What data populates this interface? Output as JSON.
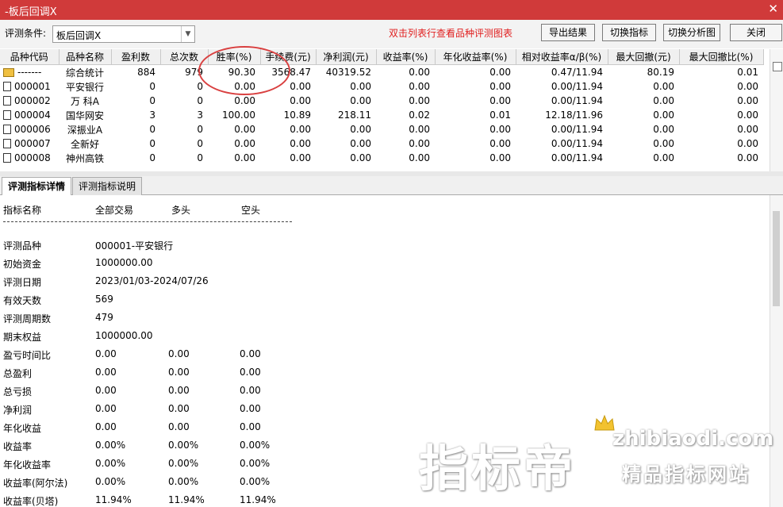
{
  "window": {
    "title": "-板后回调X",
    "close_glyph": "✕"
  },
  "toolbar": {
    "condition_label": "评测条件:",
    "condition_value": "板后回调X",
    "hint": "双击列表行查看品种评测图表",
    "buttons": [
      "导出结果",
      "切换指标",
      "切换分析图",
      "关闭"
    ]
  },
  "grid": {
    "columns": [
      "品种代码",
      "品种名称",
      "盈利数",
      "总次数",
      "胜率(%)",
      "手续费(元)",
      "净利润(元)",
      "收益率(%)",
      "年化收益率(%)",
      "相对收益率α/β(%)",
      "最大回撤(元)",
      "最大回撤比(%)"
    ],
    "rows": [
      [
        "-------",
        "综合统计",
        "884",
        "979",
        "90.30",
        "3568.47",
        "40319.52",
        "0.00",
        "0.00",
        "0.47/11.94",
        "80.19",
        "0.01"
      ],
      [
        "000001",
        "平安银行",
        "0",
        "0",
        "0.00",
        "0.00",
        "0.00",
        "0.00",
        "0.00",
        "0.00/11.94",
        "0.00",
        "0.00"
      ],
      [
        "000002",
        "万 科A",
        "0",
        "0",
        "0.00",
        "0.00",
        "0.00",
        "0.00",
        "0.00",
        "0.00/11.94",
        "0.00",
        "0.00"
      ],
      [
        "000004",
        "国华网安",
        "3",
        "3",
        "100.00",
        "10.89",
        "218.11",
        "0.02",
        "0.01",
        "12.18/11.96",
        "0.00",
        "0.00"
      ],
      [
        "000006",
        "深振业A",
        "0",
        "0",
        "0.00",
        "0.00",
        "0.00",
        "0.00",
        "0.00",
        "0.00/11.94",
        "0.00",
        "0.00"
      ],
      [
        "000007",
        "全新好",
        "0",
        "0",
        "0.00",
        "0.00",
        "0.00",
        "0.00",
        "0.00",
        "0.00/11.94",
        "0.00",
        "0.00"
      ],
      [
        "000008",
        "神州高铁",
        "0",
        "0",
        "0.00",
        "0.00",
        "0.00",
        "0.00",
        "0.00",
        "0.00/11.94",
        "0.00",
        "0.00"
      ]
    ]
  },
  "tabs": [
    "评测指标详情",
    "评测指标说明"
  ],
  "detail": {
    "header": [
      "指标名称",
      "全部交易",
      "多头",
      "空头"
    ],
    "dashes": "------------------------------------------------------------------------",
    "rows": [
      [
        "评测品种",
        "000001-平安银行",
        "",
        ""
      ],
      [
        "初始资金",
        "1000000.00",
        "",
        ""
      ],
      [
        "评测日期",
        "2023/01/03-2024/07/26",
        "",
        ""
      ],
      [
        "有效天数",
        "569",
        "",
        ""
      ],
      [
        "评测周期数",
        "479",
        "",
        ""
      ],
      [
        "期末权益",
        "1000000.00",
        "",
        ""
      ],
      [
        "盈亏时间比",
        "0.00",
        "0.00",
        "0.00"
      ],
      [
        "总盈利",
        "0.00",
        "0.00",
        "0.00"
      ],
      [
        "总亏损",
        "0.00",
        "0.00",
        "0.00"
      ],
      [
        "净利润",
        "0.00",
        "0.00",
        "0.00"
      ],
      [
        "年化收益",
        "0.00",
        "0.00",
        "0.00"
      ],
      [
        "收益率",
        "0.00%",
        "0.00%",
        "0.00%"
      ],
      [
        "年化收益率",
        "0.00%",
        "0.00%",
        "0.00%"
      ],
      [
        "收益率(阿尔法)",
        "0.00%",
        "0.00%",
        "0.00%"
      ],
      [
        "收益率(贝塔)",
        "11.94%",
        "11.94%",
        "11.94%"
      ]
    ]
  },
  "watermark": {
    "brand": "指标帝",
    "url": "zhibiaodi.com",
    "slogan": "精品指标网站"
  }
}
